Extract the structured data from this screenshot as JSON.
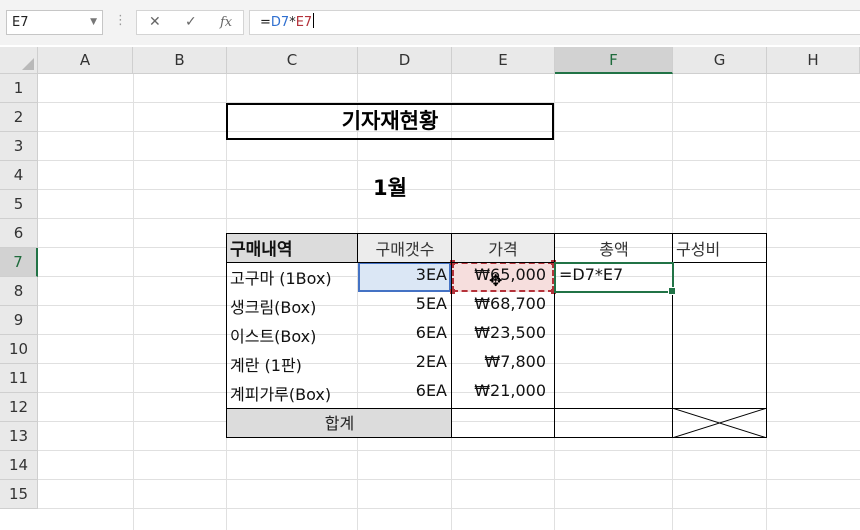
{
  "formula_bar": {
    "name_box": "E7",
    "dots": "⋮",
    "cancel": "✕",
    "enter": "✓",
    "fx": "fx",
    "formula_eq": "=",
    "formula_ref1": "D7",
    "formula_op": "*",
    "formula_ref2": "E7"
  },
  "columns": [
    "A",
    "B",
    "C",
    "D",
    "E",
    "F",
    "G",
    "H"
  ],
  "rows": [
    "1",
    "2",
    "3",
    "4",
    "5",
    "6",
    "7",
    "8",
    "9",
    "10",
    "11",
    "12",
    "13",
    "14",
    "15"
  ],
  "selected": {
    "column": "F",
    "row": "7"
  },
  "sheet": {
    "title": "기자재현황",
    "month": "1월",
    "headers": {
      "item": "구매내역",
      "qty": "구매갯수",
      "price": "가격",
      "total": "총액",
      "ratio": "구성비"
    },
    "items": [
      {
        "name": "고구마 (1Box)",
        "qty": "3EA",
        "price": "₩65,000",
        "total": "=D7*E7"
      },
      {
        "name": "생크림(Box)",
        "qty": "5EA",
        "price": "₩68,700",
        "total": ""
      },
      {
        "name": "이스트(Box)",
        "qty": "6EA",
        "price": "₩23,500",
        "total": ""
      },
      {
        "name": "계란 (1판)",
        "qty": "2EA",
        "price": "₩7,800",
        "total": ""
      },
      {
        "name": "계피가루(Box)",
        "qty": "6EA",
        "price": "₩21,000",
        "total": ""
      }
    ],
    "sum_label": "합계"
  },
  "colors": {
    "accent": "#217346",
    "ref_blue": "#4472c4",
    "ref_red": "#b4323a"
  }
}
